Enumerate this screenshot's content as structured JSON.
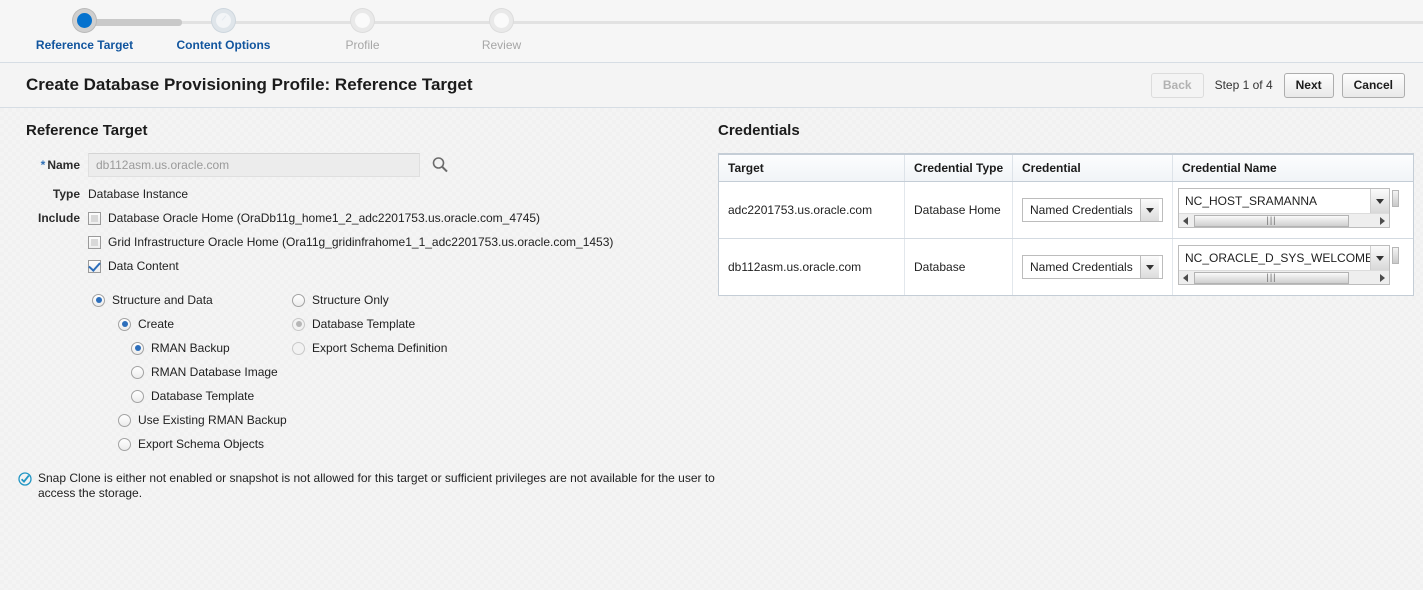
{
  "train": {
    "steps": [
      {
        "label": "Reference Target",
        "state": "current"
      },
      {
        "label": "Content Options",
        "state": "available"
      },
      {
        "label": "Profile",
        "state": "todo"
      },
      {
        "label": "Review",
        "state": "todo"
      }
    ]
  },
  "header": {
    "title": "Create Database Provisioning Profile: Reference Target",
    "back_label": "Back",
    "step_count": "Step 1 of 4",
    "next_label": "Next",
    "cancel_label": "Cancel"
  },
  "reference_target": {
    "section_title": "Reference Target",
    "name_label": "Name",
    "required_marker": "*",
    "name_value": "db112asm.us.oracle.com",
    "search_icon": "search-icon",
    "type_label": "Type",
    "type_value": "Database Instance",
    "include_label": "Include",
    "include_options": [
      {
        "label": "Database Oracle Home (OraDb11g_home1_2_adc2201753.us.oracle.com_4745)",
        "checked": false
      },
      {
        "label": "Grid Infrastructure Oracle Home (Ora11g_gridinfrahome1_1_adc2201753.us.oracle.com_1453)",
        "checked": false
      },
      {
        "label": "Data Content",
        "checked": true
      }
    ],
    "structure_left": {
      "label": "Structure and Data",
      "selected": true,
      "disabled": false
    },
    "structure_right": {
      "label": "Structure Only",
      "selected": false,
      "disabled": false
    },
    "create_option": {
      "label": "Create",
      "selected": true,
      "disabled": false
    },
    "template_option": {
      "label": "Database Template",
      "selected": true,
      "disabled": true
    },
    "export_schema_def_option": {
      "label": "Export Schema Definition",
      "selected": false,
      "disabled": true
    },
    "create_children": [
      {
        "label": "RMAN Backup",
        "selected": true
      },
      {
        "label": "RMAN Database Image",
        "selected": false
      },
      {
        "label": "Database Template",
        "selected": false
      }
    ],
    "other_options": [
      {
        "label": "Use Existing RMAN Backup",
        "selected": false
      },
      {
        "label": "Export Schema Objects",
        "selected": false
      }
    ]
  },
  "message": {
    "icon": "check-circle-icon",
    "text": "Snap Clone is either not enabled or snapshot is not allowed for this target or sufficient privileges are not available for the user to access the storage."
  },
  "credentials": {
    "section_title": "Credentials",
    "columns": [
      "Target",
      "Credential Type",
      "Credential",
      "Credential Name"
    ],
    "rows": [
      {
        "target": "adc2201753.us.oracle.com",
        "credential_type": "Database Home",
        "credential": "Named Credentials",
        "credential_name": "NC_HOST_SRAMANNA"
      },
      {
        "target": "db112asm.us.oracle.com",
        "credential_type": "Database",
        "credential": "Named Credentials",
        "credential_name": "NC_ORACLE_D_SYS_WELCOME"
      }
    ]
  },
  "colors": {
    "accent": "#0572ce",
    "link": "#11559e",
    "check": "#2c6ebb",
    "message_icon": "#2196c4"
  }
}
